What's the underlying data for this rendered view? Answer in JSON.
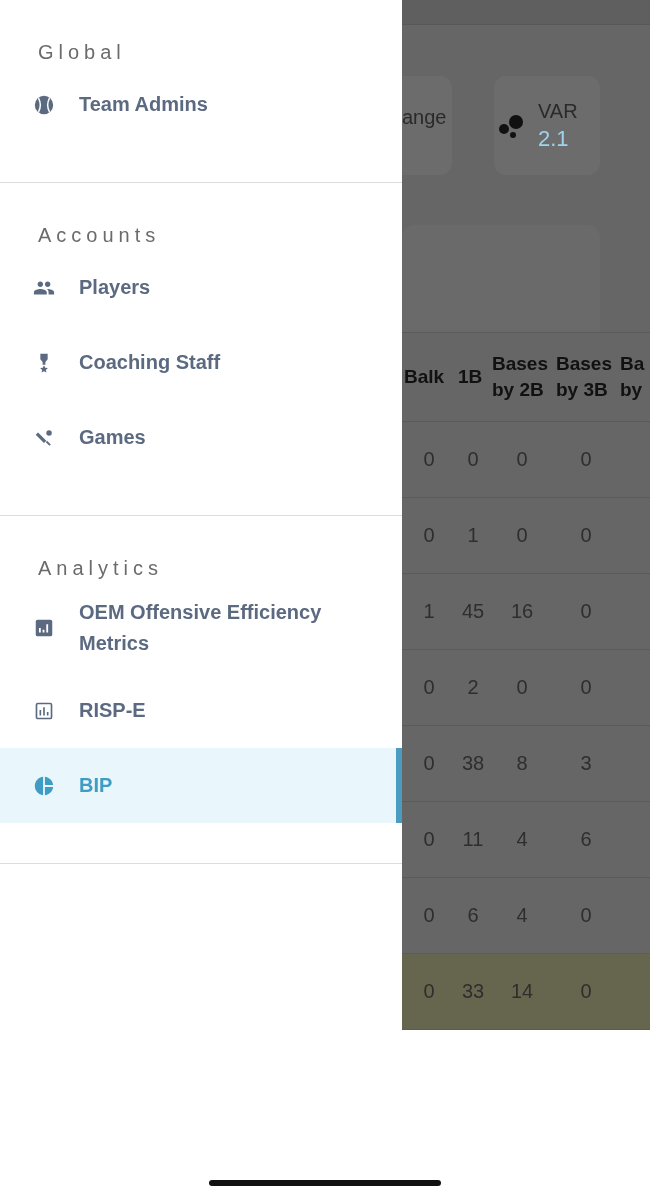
{
  "drawer": {
    "sections": [
      {
        "heading": "Global",
        "items": [
          {
            "label": "Team Admins",
            "kind": "ball",
            "selected": false
          }
        ]
      },
      {
        "heading": "Accounts",
        "items": [
          {
            "label": "Players",
            "kind": "people",
            "selected": false
          },
          {
            "label": "Coaching Staff",
            "kind": "medal",
            "selected": false
          },
          {
            "label": "Games",
            "kind": "bat",
            "selected": false
          }
        ]
      },
      {
        "heading": "Analytics",
        "items": [
          {
            "label": "OEM Offensive Efficiency Metrics",
            "kind": "chart-filled",
            "selected": false
          },
          {
            "label": "RISP-E",
            "kind": "chart-outline",
            "selected": false
          },
          {
            "label": "BIP",
            "kind": "pie",
            "selected": true
          }
        ]
      }
    ]
  },
  "background_page": {
    "stat_cards": [
      {
        "label": "ange"
      },
      {
        "label": "VAR",
        "value": "2.1"
      }
    ],
    "table": {
      "columns": [
        "Balk",
        "1B",
        "Bases by 2B",
        "Bases by 3B",
        "Ba by"
      ],
      "rows": [
        {
          "cells": [
            "0",
            "0",
            "0",
            "0"
          ],
          "highlighted": false
        },
        {
          "cells": [
            "0",
            "1",
            "0",
            "0"
          ],
          "highlighted": false
        },
        {
          "cells": [
            "1",
            "45",
            "16",
            "0"
          ],
          "highlighted": false
        },
        {
          "cells": [
            "0",
            "2",
            "0",
            "0"
          ],
          "highlighted": false
        },
        {
          "cells": [
            "0",
            "38",
            "8",
            "3"
          ],
          "highlighted": false
        },
        {
          "cells": [
            "0",
            "11",
            "4",
            "6"
          ],
          "highlighted": false
        },
        {
          "cells": [
            "0",
            "6",
            "4",
            "0"
          ],
          "highlighted": false
        },
        {
          "cells": [
            "0",
            "33",
            "14",
            "0"
          ],
          "highlighted": true
        }
      ]
    }
  }
}
